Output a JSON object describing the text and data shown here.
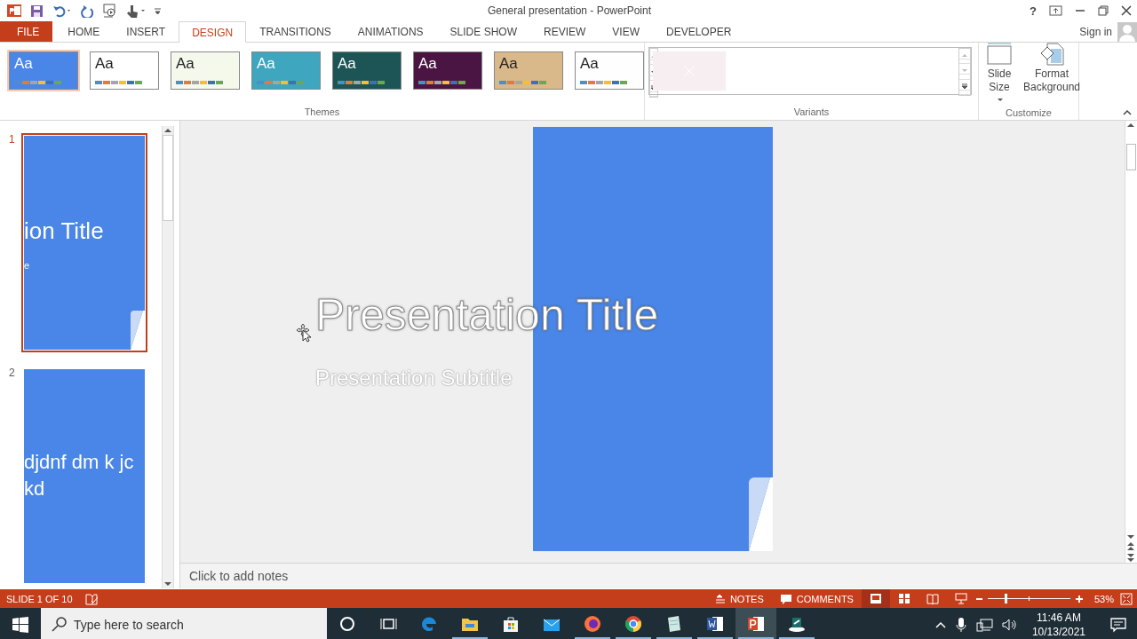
{
  "window": {
    "title": "General presentation - PowerPoint",
    "help": "?",
    "sign_in": "Sign in"
  },
  "ribbon_tabs": [
    {
      "label": "FILE",
      "kind": "file",
      "selected": false
    },
    {
      "label": "HOME",
      "kind": "tab",
      "selected": false
    },
    {
      "label": "INSERT",
      "kind": "tab",
      "selected": false
    },
    {
      "label": "DESIGN",
      "kind": "tab",
      "selected": true
    },
    {
      "label": "TRANSITIONS",
      "kind": "tab",
      "selected": false
    },
    {
      "label": "ANIMATIONS",
      "kind": "tab",
      "selected": false
    },
    {
      "label": "SLIDE SHOW",
      "kind": "tab",
      "selected": false
    },
    {
      "label": "REVIEW",
      "kind": "tab",
      "selected": false
    },
    {
      "label": "VIEW",
      "kind": "tab",
      "selected": false
    },
    {
      "label": "DEVELOPER",
      "kind": "tab",
      "selected": false
    }
  ],
  "themes": {
    "label": "Themes",
    "items": [
      {
        "text": "Aa",
        "selected": true,
        "color": "#4a86e8"
      },
      {
        "text": "Aa",
        "selected": false,
        "color": "#ffffff"
      },
      {
        "text": "Aa",
        "selected": false,
        "color": "#f4f9ec"
      },
      {
        "text": "Aa",
        "selected": false,
        "color": "#3ea6bf"
      },
      {
        "text": "Aa",
        "selected": false,
        "color": "#1d5556"
      },
      {
        "text": "Aa",
        "selected": false,
        "color": "#4a1542"
      },
      {
        "text": "Aa",
        "selected": false,
        "color": "#d9b889"
      },
      {
        "text": "Aa",
        "selected": false,
        "color": "#fefefe"
      }
    ]
  },
  "variants": {
    "label": "Variants"
  },
  "customize": {
    "label": "Customize",
    "buttons": [
      {
        "kind": "slide_size",
        "lines": [
          "Slide",
          "Size"
        ]
      },
      {
        "kind": "format_background",
        "lines": [
          "Format",
          "Background"
        ]
      }
    ]
  },
  "slides": [
    {
      "number": "1",
      "selected": true,
      "texts": [
        "ion Title",
        "e"
      ]
    },
    {
      "number": "2",
      "selected": false,
      "texts": [
        "djdnf dm k jc",
        "kd"
      ]
    }
  ],
  "editor": {
    "title": "Presentation Title",
    "subtitle": "Presentation Subtitle",
    "notes_placeholder": "Click to add notes"
  },
  "status_bar": {
    "slide_info": "SLIDE 1 OF 10",
    "notes": "NOTES",
    "comments": "COMMENTS",
    "views": [
      {
        "kind": "normal",
        "selected": true
      },
      {
        "kind": "sorter",
        "selected": false
      },
      {
        "kind": "reading",
        "selected": false
      },
      {
        "kind": "slideshow",
        "selected": false
      }
    ],
    "zoom": {
      "level": 0.22,
      "reading": "53%"
    }
  },
  "taskbar": {
    "search_placeholder": "Type here to search",
    "time": "11:46 AM",
    "date": "10/13/2021",
    "apps": [
      {
        "kind": "cortana",
        "running": false,
        "selected": false
      },
      {
        "kind": "taskview",
        "running": false,
        "selected": false
      },
      {
        "kind": "edge",
        "running": false,
        "selected": false
      },
      {
        "kind": "explorer",
        "running": true,
        "selected": false
      },
      {
        "kind": "store",
        "running": false,
        "selected": false
      },
      {
        "kind": "mail",
        "running": false,
        "selected": false
      },
      {
        "kind": "firefox",
        "running": true,
        "selected": false
      },
      {
        "kind": "chrome",
        "running": true,
        "selected": false
      },
      {
        "kind": "notepad",
        "running": true,
        "selected": false
      },
      {
        "kind": "word",
        "running": true,
        "selected": false
      },
      {
        "kind": "powerpoint",
        "running": true,
        "selected": true
      },
      {
        "kind": "recorder",
        "running": true,
        "selected": false
      }
    ]
  }
}
